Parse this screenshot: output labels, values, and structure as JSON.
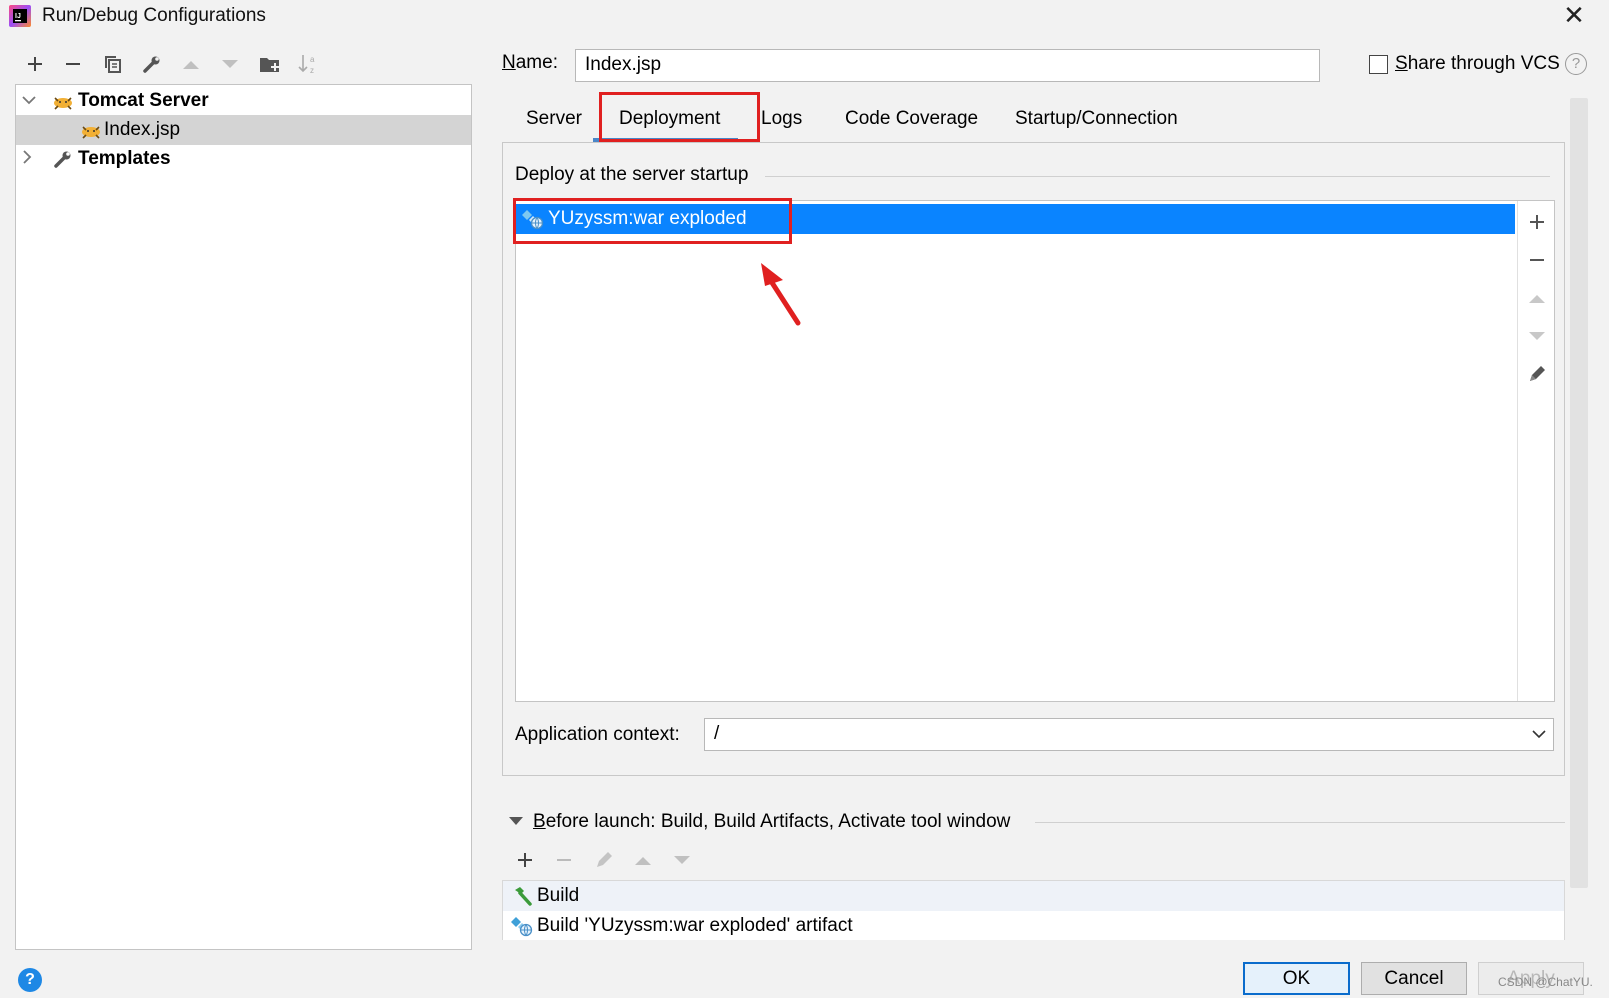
{
  "window": {
    "title": "Run/Debug Configurations",
    "close": "✕"
  },
  "left_toolbar": {
    "icons": [
      "add-icon",
      "remove-icon",
      "copy-icon",
      "wrench-icon",
      "move-up-icon",
      "move-down-icon",
      "new-folder-icon",
      "sort-icon"
    ]
  },
  "tree": {
    "items": [
      {
        "label": "Tomcat Server",
        "expanded": true,
        "icon": "tomcat-icon"
      },
      {
        "label": "Index.jsp",
        "selected": true,
        "icon": "tomcat-icon"
      },
      {
        "label": "Templates",
        "expanded": false,
        "icon": "wrench-icon"
      }
    ]
  },
  "config": {
    "name_label": "Name:",
    "name_label_mnemonic": "N",
    "name_label_rest": "ame:",
    "name_value": "Index.jsp",
    "share_vcs_label": "Share through VCS",
    "share_vcs_mnemonic": "S",
    "share_vcs_rest": "hare through VCS",
    "share_vcs_checked": false,
    "help": "?"
  },
  "tabs": [
    {
      "label": "Server",
      "active": false
    },
    {
      "label": "Deployment",
      "active": true
    },
    {
      "label": "Logs",
      "active": false
    },
    {
      "label": "Code Coverage",
      "active": false
    },
    {
      "label": "Startup/Connection",
      "active": false
    }
  ],
  "deployment": {
    "section_title": "Deploy at the server startup",
    "artifacts": [
      {
        "label": "YUzyssm:war exploded",
        "selected": true,
        "icon": "artifact-icon"
      }
    ],
    "side_tools": [
      "add-icon",
      "remove-icon",
      "move-up-icon",
      "move-down-icon",
      "edit-icon"
    ],
    "app_context_label": "Application context:",
    "app_context_value": "/"
  },
  "before_launch": {
    "label_mnemonic": "B",
    "label_rest": "efore launch: Build, Build Artifacts, Activate tool window",
    "tools": [
      "add-icon",
      "remove-icon",
      "edit-icon",
      "move-up-icon",
      "move-down-icon"
    ],
    "items": [
      {
        "label": "Build",
        "icon": "hammer-icon"
      },
      {
        "label": "Build 'YUzyssm:war exploded' artifact",
        "icon": "artifact-icon"
      }
    ]
  },
  "buttons": {
    "ok": "OK",
    "cancel": "Cancel",
    "apply": "Apply",
    "help": "?"
  },
  "watermark": "CSDN @ChatYU.",
  "colors": {
    "selection": "#0a84ff",
    "tab_underline": "#4a86c8",
    "annotation": "#e02020"
  }
}
